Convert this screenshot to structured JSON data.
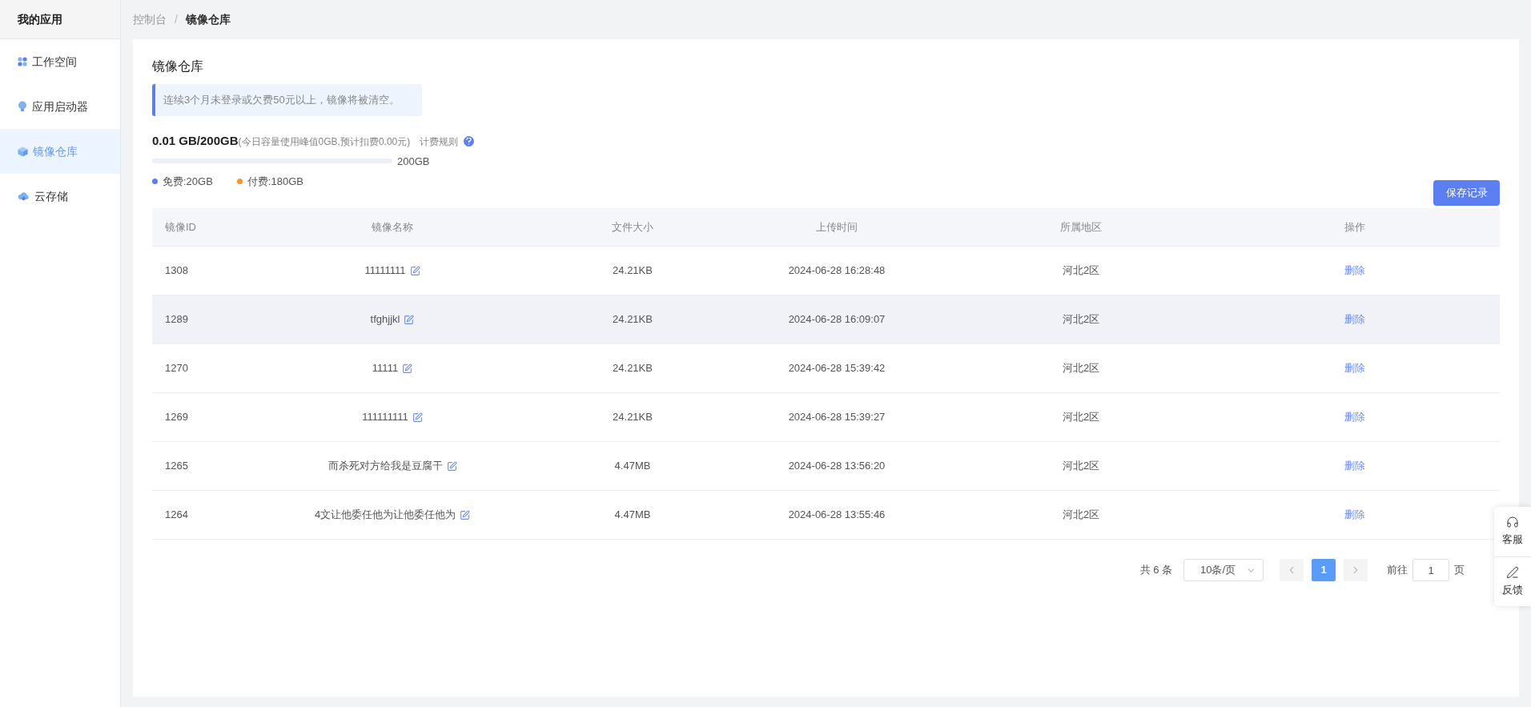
{
  "sidebar": {
    "title": "我的应用",
    "items": [
      {
        "label": "工作空间",
        "selected": false
      },
      {
        "label": "应用启动器",
        "selected": false
      },
      {
        "label": "镜像仓库",
        "selected": true
      },
      {
        "label": "云存储",
        "selected": false
      }
    ]
  },
  "breadcrumb": [
    {
      "label": "控制台",
      "current": false
    },
    {
      "label": "镜像仓库",
      "current": true
    }
  ],
  "breadcrumb_separator": "/",
  "page_title": "镜像仓库",
  "notice": "连续3个月未登录或欠费50元以上，镜像将被清空。",
  "storage": {
    "usage": "0.01 GB/200GB",
    "detail": "(今日容量使用峰值0GB,预计扣费0.00元)",
    "rules_link": "计费规则",
    "level": 0,
    "capacity": "200GB",
    "legend": [
      {
        "label": "免费:20GB",
        "color": "#5b7ff0"
      },
      {
        "label": "付费:180GB",
        "color": "#f5962f"
      }
    ]
  },
  "save_button": "保存记录",
  "table": {
    "columns": [
      "镜像ID",
      "镜像名称",
      "文件大小",
      "上传时间",
      "所属地区",
      "操作"
    ],
    "rows": [
      {
        "id": "1308",
        "name": "11111111",
        "size": "24.21KB",
        "time": "2024-06-28 16:28:48",
        "region": "河北2区",
        "action": "删除",
        "selected": false
      },
      {
        "id": "1289",
        "name": "tfghjjkl",
        "size": "24.21KB",
        "time": "2024-06-28 16:09:07",
        "region": "河北2区",
        "action": "删除",
        "selected": true
      },
      {
        "id": "1270",
        "name": "11111",
        "size": "24.21KB",
        "time": "2024-06-28 15:39:42",
        "region": "河北2区",
        "action": "删除",
        "selected": false
      },
      {
        "id": "1269",
        "name": "111111111",
        "size": "24.21KB",
        "time": "2024-06-28 15:39:27",
        "region": "河北2区",
        "action": "删除",
        "selected": false
      },
      {
        "id": "1265",
        "name": "而杀死对方给我是豆腐干",
        "size": "4.47MB",
        "time": "2024-06-28 13:56:20",
        "region": "河北2区",
        "action": "删除",
        "selected": false
      },
      {
        "id": "1264",
        "name": "4文让他委任他为让他委任他为",
        "size": "4.47MB",
        "time": "2024-06-28 13:55:46",
        "region": "河北2区",
        "action": "删除",
        "selected": false
      }
    ]
  },
  "pagination": {
    "total": "共 6 条",
    "page_size": "10条/页",
    "pages": [
      {
        "label": "1",
        "selected": true
      }
    ],
    "goto_label": "前往",
    "goto_value": "1",
    "goto_suffix": "页"
  },
  "float_panel": [
    {
      "label": "客服"
    },
    {
      "label": "反馈"
    }
  ]
}
